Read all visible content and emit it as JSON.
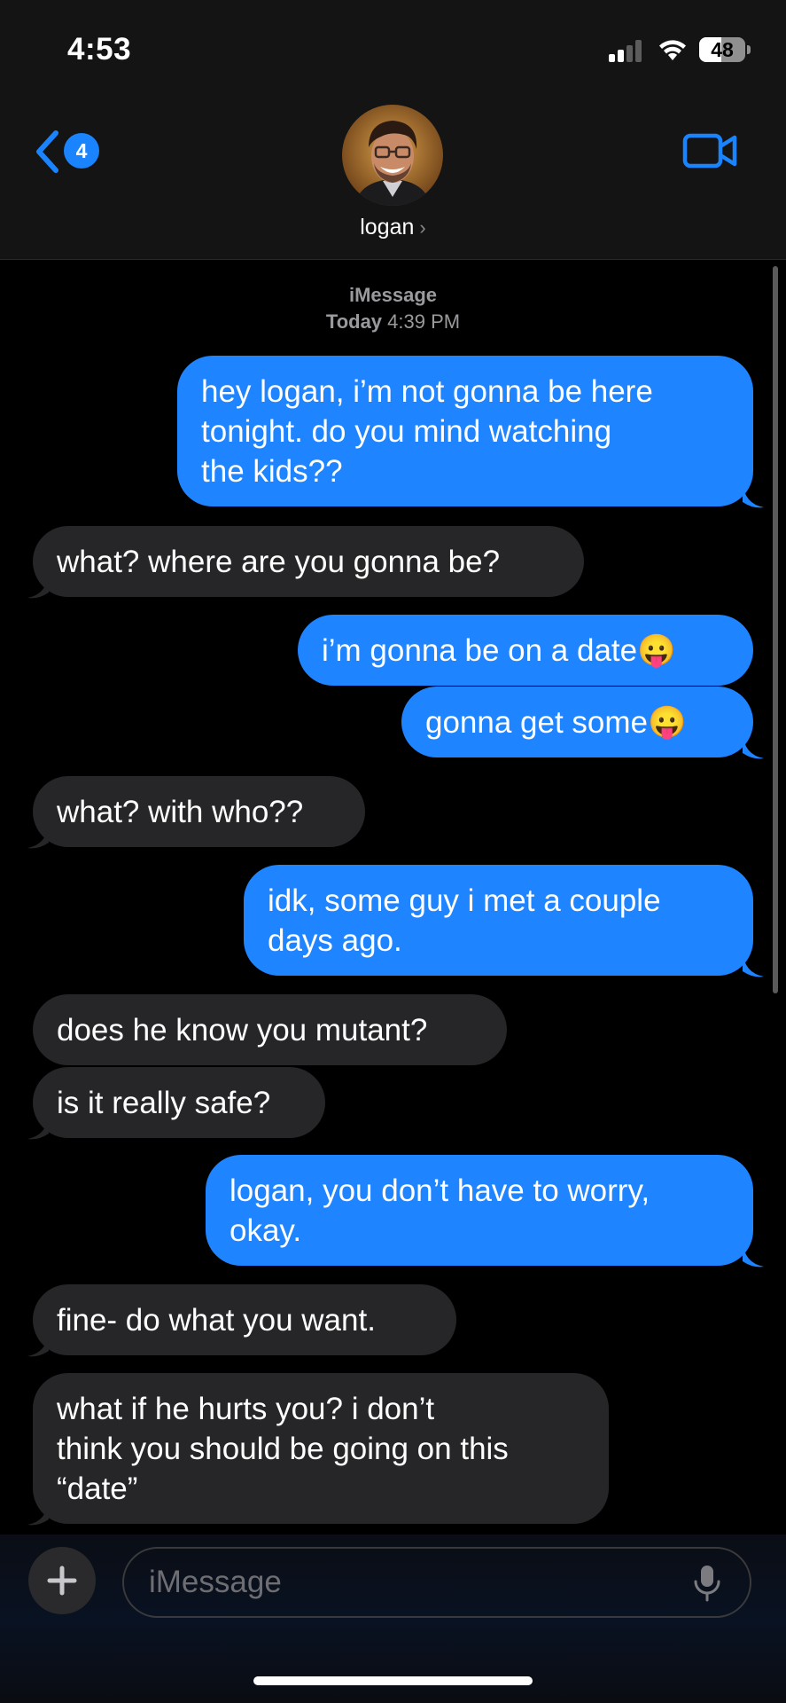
{
  "status_bar": {
    "time": "4:53",
    "battery": "48",
    "battery_level": 0.48,
    "icons": [
      "signal-icon",
      "wifi-icon",
      "battery-icon"
    ]
  },
  "header": {
    "back_badge": "4",
    "contact_name": "logan",
    "chevron": "›",
    "icons": [
      "back-chevron-icon",
      "video-call-icon",
      "avatar"
    ]
  },
  "thread": {
    "service": "iMessage",
    "date_label": "Today",
    "time": "4:39 PM"
  },
  "messages": [
    {
      "dir": "out",
      "lines": [
        "hey logan, i’m not gonna be here",
        "tonight. do you mind watching",
        "the kids??"
      ]
    },
    {
      "dir": "in",
      "lines": [
        "what? where are you gonna be?"
      ]
    },
    {
      "dir": "out",
      "lines": [
        "i’m gonna be on a date😛"
      ]
    },
    {
      "dir": "out",
      "lines": [
        "gonna get some😛"
      ]
    },
    {
      "dir": "in",
      "lines": [
        "what? with who??"
      ]
    },
    {
      "dir": "out",
      "lines": [
        "idk, some guy i met a couple",
        "days ago."
      ]
    },
    {
      "dir": "in",
      "lines": [
        "does he know you mutant?"
      ]
    },
    {
      "dir": "in",
      "lines": [
        "is it really safe?"
      ]
    },
    {
      "dir": "out",
      "lines": [
        "logan, you don’t have to worry,",
        "okay."
      ]
    },
    {
      "dir": "in",
      "lines": [
        "fine- do what you want."
      ]
    },
    {
      "dir": "in",
      "lines": [
        "what if he hurts you? i don’t",
        "think you should be going on this",
        "“date”"
      ]
    }
  ],
  "composer": {
    "placeholder": "iMessage",
    "icons": [
      "plus-icon",
      "microphone-icon"
    ]
  },
  "colors": {
    "outgoing": "#1f84ff",
    "incoming": "#262628",
    "background": "#000000",
    "accent": "#1a84ff"
  }
}
